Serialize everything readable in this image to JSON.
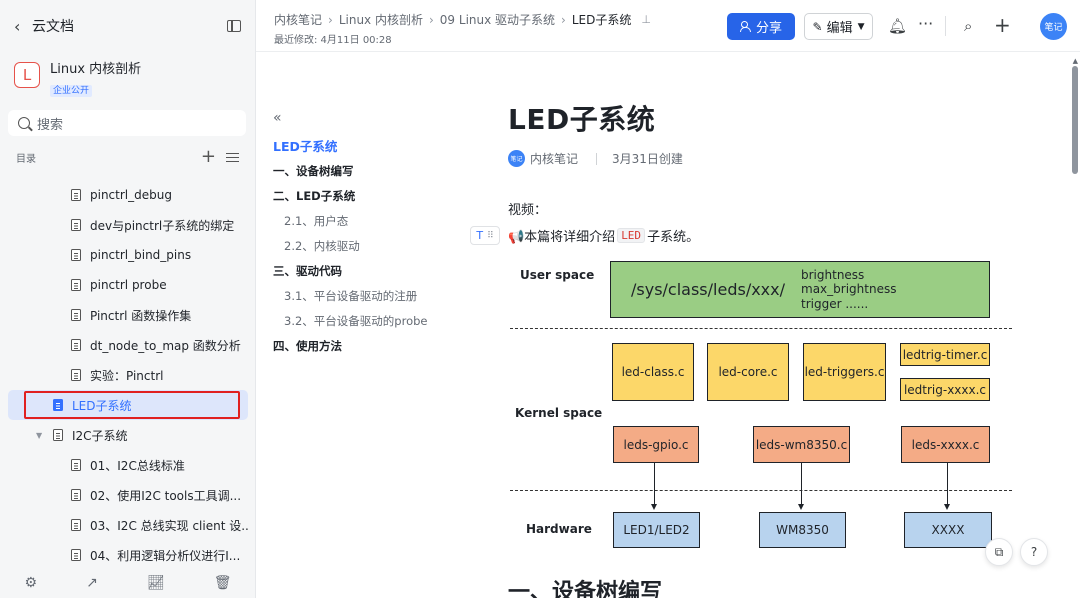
{
  "sidebar": {
    "app_name": "云文档",
    "kb_logo_letter": "L",
    "kb_title": "Linux 内核剖析",
    "kb_badge": "企业公开",
    "search_placeholder": "搜索",
    "toc_label": "目录",
    "items": [
      {
        "label": "pinctrl_debug"
      },
      {
        "label": "dev与pinctrl子系统的绑定"
      },
      {
        "label": "pinctrl_bind_pins"
      },
      {
        "label": "pinctrl probe"
      },
      {
        "label": "Pinctrl 函数操作集"
      },
      {
        "label": "dt_node_to_map 函数分析"
      },
      {
        "label": "实验：Pinctrl"
      },
      {
        "label": "LED子系统"
      },
      {
        "label": "I2C子系统"
      },
      {
        "label": "01、I2C总线标准"
      },
      {
        "label": "02、使用I2C tools工具调..."
      },
      {
        "label": "03、I2C 总线实现 client 设..."
      },
      {
        "label": "04、利用逻辑分析仪进行I..."
      }
    ]
  },
  "header": {
    "breadcrumbs": [
      "内核笔记",
      "Linux 内核剖析",
      "09 Linux 驱动子系统",
      "LED子系统"
    ],
    "modified": "最近修改: 4月11日 00:28",
    "share_label": "分享",
    "edit_label": "编辑",
    "avatar_text": "笔记"
  },
  "toc": {
    "items": [
      {
        "label": "LED子系统"
      },
      {
        "label": "一、设备树编写"
      },
      {
        "label": "二、LED子系统"
      },
      {
        "label": "2.1、用户态"
      },
      {
        "label": "2.2、内核驱动"
      },
      {
        "label": "三、驱动代码"
      },
      {
        "label": "3.1、平台设备驱动的注册"
      },
      {
        "label": "3.2、平台设备驱动的probe"
      },
      {
        "label": "四、使用方法"
      }
    ]
  },
  "doc": {
    "title": "LED子系统",
    "author_avatar": "笔记",
    "author": "内核笔记",
    "created": "3月31日创建",
    "video_label": "视频：",
    "intro_prefix": "📢本篇将详细介绍",
    "intro_code": "LED",
    "intro_suffix": "子系统。",
    "next_heading": "一、设备树编写"
  },
  "diagram": {
    "layers": {
      "user": "User space",
      "kernel": "Kernel space",
      "hardware": "Hardware"
    },
    "sysfs_path": "/sys/class/leds/xxx/",
    "sysfs_attrs": [
      "brightness",
      "max_brightness",
      "trigger ......"
    ],
    "core_boxes": [
      "led-class.c",
      "led-core.c",
      "led-triggers.c"
    ],
    "trigger_boxes": [
      "ledtrig-timer.c",
      "ledtrig-xxxx.c"
    ],
    "driver_boxes": [
      "leds-gpio.c",
      "leds-wm8350.c",
      "leds-xxxx.c"
    ],
    "hw_boxes": [
      "LED1/LED2",
      "WM8350",
      "XXXX"
    ]
  },
  "colors": {
    "accent": "#2764e8",
    "user_space_box": "#9acd84",
    "core_box": "#fcd769",
    "driver_box": "#f4ab86",
    "hardware_box": "#b8d3ee",
    "highlight_border": "#e02020"
  }
}
